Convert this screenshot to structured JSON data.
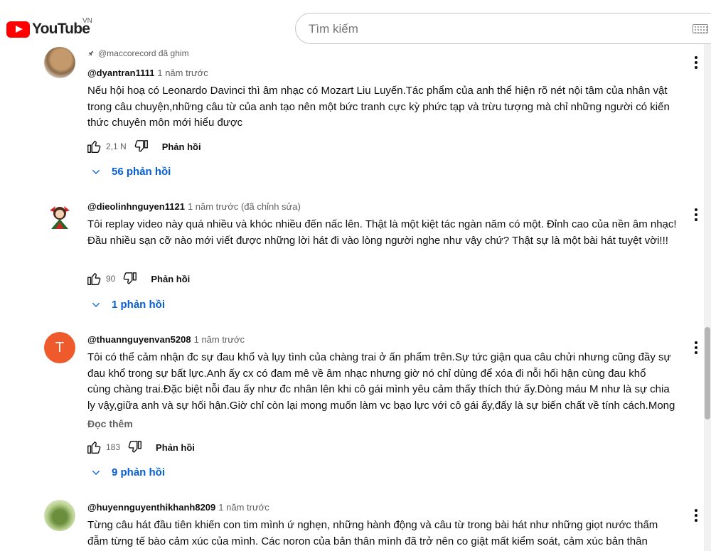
{
  "app": {
    "logo_text": "YouTube",
    "country": "VN"
  },
  "search": {
    "placeholder": "Tìm kiếm"
  },
  "comments": [
    {
      "pinned": "@maccorecord đã ghim",
      "author": "@dyantran1111",
      "time": "1 năm trước",
      "text": "Nếu hội hoạ có Leonardo Davinci thì âm nhạc có Mozart Liu Luyến.Tác phẩm của anh thể hiện rõ nét nội tâm của nhân vật trong câu chuyện,những câu từ của anh tạo nên một bức tranh cực kỳ phức tạp và trừu tượng mà chỉ những người có kiến thức chuyên môn mới hiểu được",
      "likes": "2,1 N",
      "reply_label": "Phản hồi",
      "replies": "56 phản hồi"
    },
    {
      "author": "@dieolinhnguyen1121",
      "time": "1 năm trước (đã chỉnh sửa)",
      "text": "Tôi replay video này quá nhiều và khóc nhiều đến nấc lên. Thật là một kiệt tác ngàn năm có một. Đỉnh cao của nền âm nhạc! Đầu nhiều sạn cỡ nào mới viết được những lời hát đi vào lòng người  nghe như vậy chứ? Thật sự là một bài hát tuyệt vời!!!",
      "likes": "90",
      "reply_label": "Phản hồi",
      "replies": "1 phản hồi"
    },
    {
      "author": "@thuannguyenvan5208",
      "avatar_letter": "T",
      "time": "1 năm trước",
      "text_lines": [
        "Tôi có thể cảm nhận đc sự đau khổ và lụy tình của chàng trai ở ấn phẩm trên.Sự tức giận qua câu chửi nhưng cũng đầy sự",
        "đau khổ trong sự bất lực.Anh ấy cx có đam mê về âm nhạc nhưng giờ nó chỉ dùng để xóa đi nỗi hối hận cùng đau khổ",
        "cùng chàng trai.Đặc biệt nỗi đau ấy như đc nhân lên khi cô gái mình yêu cảm thấy thích thứ ấy.Dòng máu M như là sự chia",
        "ly vậy,giữa anh và sự hối hận.Giờ chỉ còn lại mong muốn làm vc bạo lực với cô gái ấy,đấy là sự biến chất về tính cách.Mong"
      ],
      "read_more": "Đọc thêm",
      "likes": "183",
      "reply_label": "Phản hồi",
      "replies": "9 phản hồi"
    },
    {
      "author": "@huyennguyenthikhanh8209",
      "time": "1 năm trước",
      "text_lines": [
        "Từng câu hát đầu tiên khiến con tim mình ứ nghẹn, những hành động và câu từ trong bài hát như những giọt nước thấm",
        "đẫm từng tế bào cảm xúc của mình. Các noron của bản thân mình đã trở nên co giật mất kiểm soát, cảm xúc bản thân"
      ]
    }
  ],
  "colors": {
    "brand": "#ff0000",
    "link": "#065fd4",
    "secondary_text": "#606060",
    "avatar_t": "#ef5a2c"
  },
  "icons": [
    "youtube-logo-icon",
    "keyboard-icon",
    "pin-icon",
    "like-icon",
    "dislike-icon",
    "chevron-down-icon",
    "more-vert-icon"
  ]
}
